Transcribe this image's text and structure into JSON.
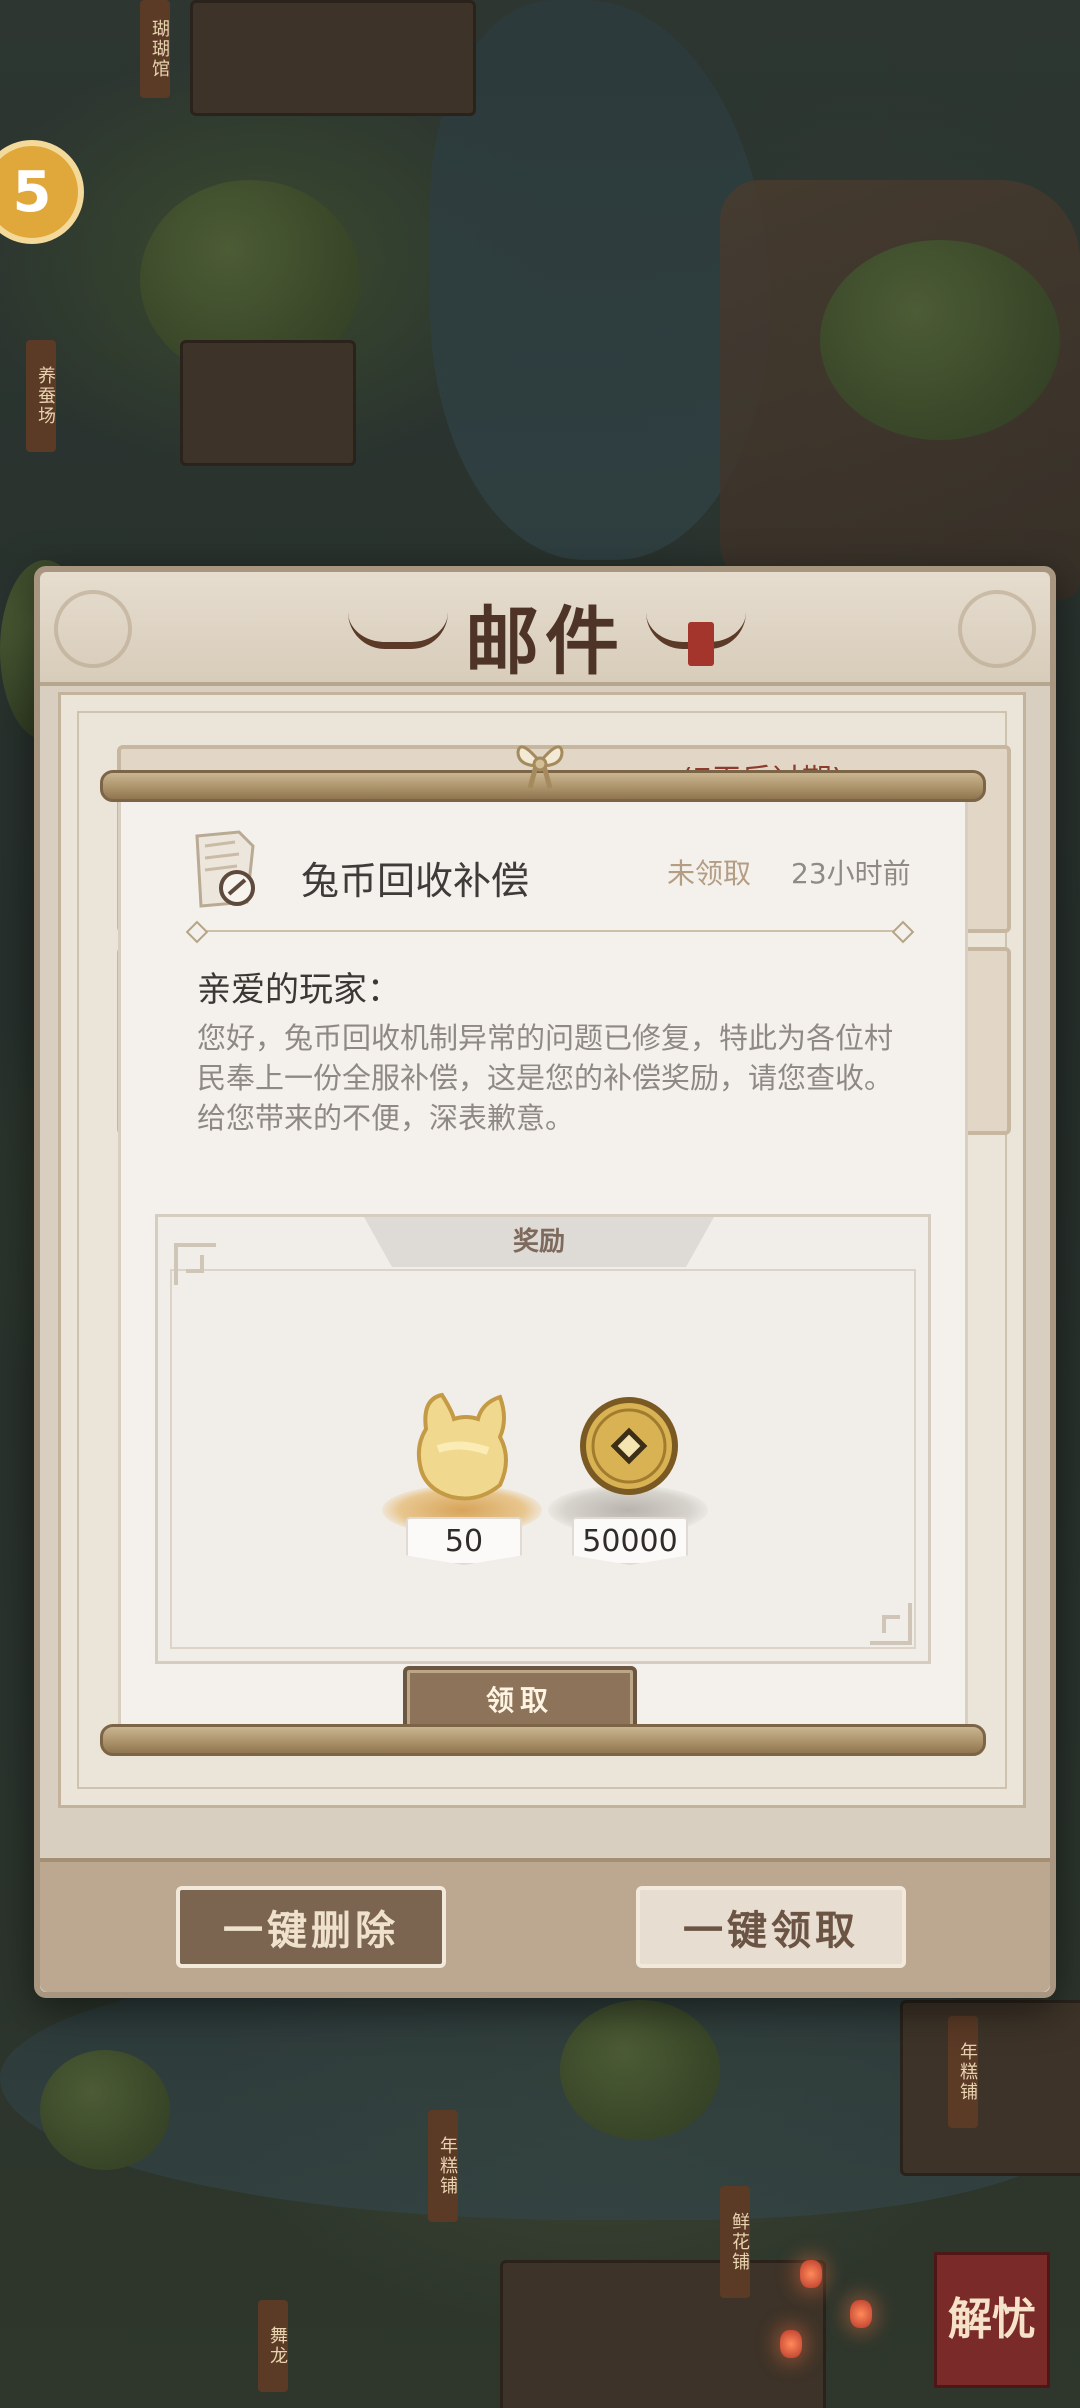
{
  "background": {
    "signposts": [
      "瑚瑚馆",
      "养蚕场",
      "年糕铺",
      "年糕铺",
      "鲜花铺",
      "舞龙"
    ],
    "corner_button": "解忧"
  },
  "mail_dialog": {
    "title": "邮件",
    "peek_text": "(7天后过期)",
    "footer": {
      "delete_all": "一键删除",
      "claim_all": "一键领取"
    }
  },
  "mail_detail": {
    "subject": "兔币回收补偿",
    "status": "未领取",
    "time": "23小时前",
    "greeting": "亲爱的玩家：",
    "body": "您好，兔币回收机制异常的问题已修复，特此为各位村民奉上一份全服补偿，这是您的补偿奖励，请您查收。给您带来的不便，深表歉意。",
    "reward_title": "奖励",
    "rewards": [
      {
        "icon": "rabbit-coin-icon",
        "count": "50"
      },
      {
        "icon": "copper-coin-icon",
        "count": "50000"
      }
    ],
    "claim_label": "领取"
  },
  "colors": {
    "accent_brown": "#8c7359",
    "title_brown": "#4e3426",
    "paper": "#f4f1ec",
    "seal_red": "#a3352c"
  }
}
